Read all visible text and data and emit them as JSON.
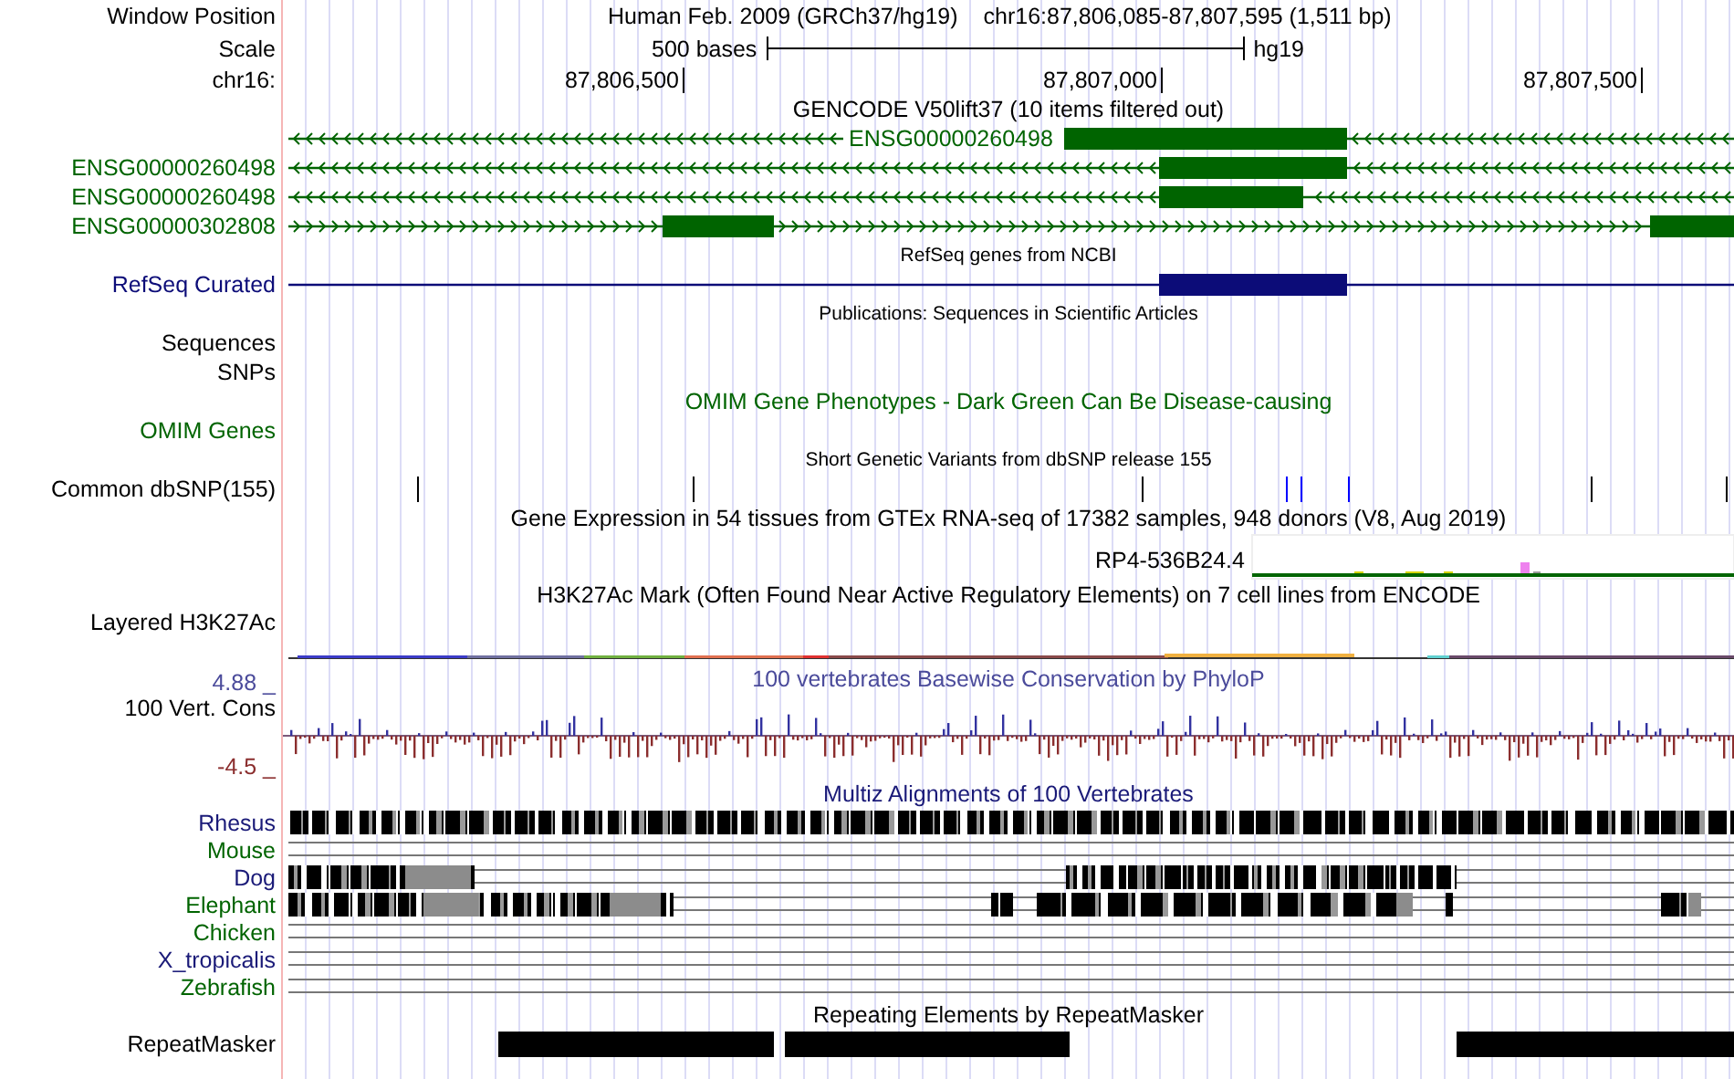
{
  "rows": [
    {
      "kind": "position",
      "label": "Window Position",
      "assembly": "Human Feb. 2009 (GRCh37/hg19)",
      "range": "chr16:87,806,085-87,807,595 (1,511 bp)"
    },
    {
      "kind": "scale",
      "label": "Scale",
      "length": "500 bases",
      "assembly": "hg19"
    },
    {
      "kind": "ruler",
      "label": "chr16:",
      "ticks": [
        "87,806,500",
        "87,807,000",
        "87,807,500"
      ]
    },
    {
      "kind": "title",
      "text": "GENCODE V50lift37 (10 items filtered out)",
      "color": "#000000"
    },
    {
      "kind": "gene",
      "label": "ENSG00000260498",
      "label_inside": true,
      "arrows": true,
      "reverse": true,
      "color": "#006400"
    },
    {
      "kind": "gene",
      "label": "ENSG00000260498",
      "label_inside": false,
      "arrows": true,
      "reverse": true,
      "color": "#006400"
    },
    {
      "kind": "gene",
      "label": "ENSG00000260498",
      "label_inside": false,
      "arrows": true,
      "reverse": true,
      "color": "#006400"
    },
    {
      "kind": "gene",
      "label": "ENSG00000302808",
      "label_inside": false,
      "arrows": true,
      "reverse": false,
      "color": "#006400"
    },
    {
      "kind": "caption",
      "text": "RefSeq genes from NCBI"
    },
    {
      "kind": "gene",
      "label": "RefSeq Curated",
      "label_inside": false,
      "arrows": false,
      "color": "#0c0c78"
    },
    {
      "kind": "caption",
      "text": "Publications: Sequences in Scientific Articles"
    },
    {
      "kind": "label",
      "label": "Sequences",
      "color": "#000000"
    },
    {
      "kind": "label",
      "label": "SNPs",
      "color": "#000000"
    },
    {
      "kind": "title",
      "text": "OMIM Gene Phenotypes - Dark Green Can Be Disease-causing",
      "color": "#006400"
    },
    {
      "kind": "label",
      "label": "OMIM Genes",
      "color": "#006400"
    },
    {
      "kind": "caption",
      "text": "Short Genetic Variants from dbSNP release 155"
    },
    {
      "kind": "snp",
      "label": "Common dbSNP(155)"
    },
    {
      "kind": "title",
      "text": "Gene Expression in 54 tissues from GTEx RNA-seq of 17382 samples, 948 donors (V8, Aug 2019)",
      "color": "#000000"
    },
    {
      "kind": "gtex",
      "gene": "RP4-536B24.4"
    },
    {
      "kind": "title",
      "text": "H3K27Ac Mark (Often Found Near Active Regulatory Elements) on 7 cell lines from ENCODE",
      "color": "#000000"
    },
    {
      "kind": "signal",
      "label": "Layered H3K27Ac"
    },
    {
      "kind": "cons-max",
      "label": "4.88 _",
      "text": "100 vertebrates Basewise Conservation by PhyloP",
      "color": "#4b4b9b"
    },
    {
      "kind": "cons",
      "label": "100 Vert. Cons",
      "min_label": "-4.5 _"
    },
    {
      "kind": "title",
      "text": "Multiz Alignments of 100 Vertebrates",
      "color": "#1a1a78"
    },
    {
      "kind": "species",
      "label": "Rhesus",
      "color": "#1a1a78"
    },
    {
      "kind": "species",
      "label": "Mouse",
      "color": "#006400"
    },
    {
      "kind": "species",
      "label": "Dog",
      "color": "#1a1a78"
    },
    {
      "kind": "species",
      "label": "Elephant",
      "color": "#006400"
    },
    {
      "kind": "species",
      "label": "Chicken",
      "color": "#006400"
    },
    {
      "kind": "species",
      "label": "X_tropicalis",
      "color": "#1a1a78"
    },
    {
      "kind": "species",
      "label": "Zebrafish",
      "color": "#006400"
    },
    {
      "kind": "title",
      "text": "Repeating Elements by RepeatMasker",
      "color": "#000000"
    },
    {
      "kind": "repeat",
      "label": "RepeatMasker"
    }
  ]
}
